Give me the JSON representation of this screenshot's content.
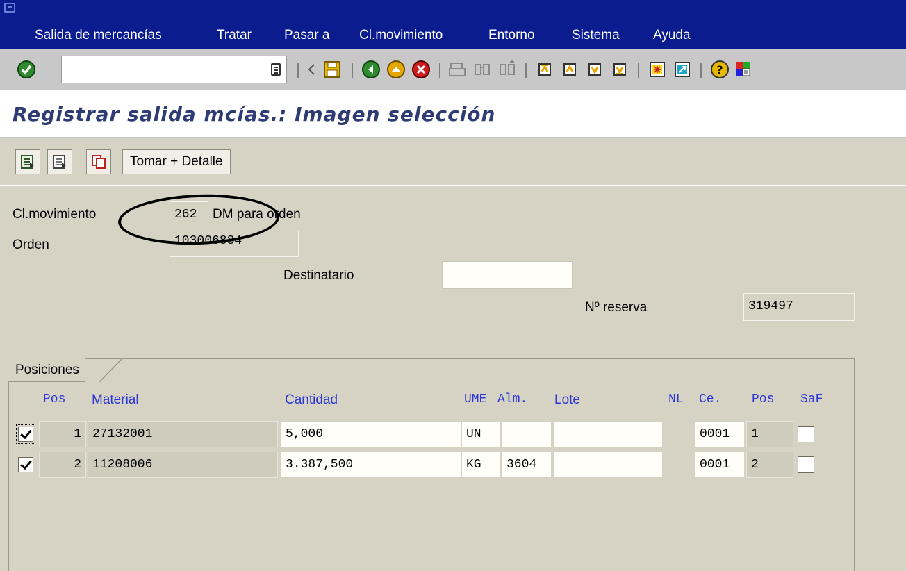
{
  "menu": {
    "items": [
      {
        "label": "Salida de mercancías"
      },
      {
        "label": "Tratar"
      },
      {
        "label": "Pasar a"
      },
      {
        "label": "Cl.movimiento"
      },
      {
        "label": "Entorno"
      },
      {
        "label": "Sistema"
      },
      {
        "label": "Ayuda"
      }
    ]
  },
  "toolbar": {
    "command_value": "",
    "icons": [
      "enter-icon",
      "command-history-icon",
      "back-triangle-icon",
      "save-icon",
      "back-icon",
      "exit-icon",
      "cancel-icon",
      "print-icon",
      "find-icon",
      "find-next-icon",
      "first-page-icon",
      "previous-page-icon",
      "next-page-icon",
      "last-page-icon",
      "create-session-icon",
      "shortcut-icon",
      "help-icon",
      "layout-menu-icon"
    ]
  },
  "title": "Registrar salida mcías.: Imagen selección",
  "app_toolbar": {
    "icons": [
      "select-all-icon",
      "deselect-all-icon",
      "copy-icon"
    ],
    "detail_button": "Tomar + Detalle"
  },
  "header": {
    "movement_label": "Cl.movimiento",
    "movement_value": "262",
    "movement_text": "DM para orden",
    "order_label": "Orden",
    "order_value": "103006884",
    "recipient_label": "Destinatario",
    "recipient_value": "",
    "reservation_label": "Nº reserva",
    "reservation_value": "319497"
  },
  "positions": {
    "tab_label": "Posiciones",
    "columns": {
      "pos": "Pos",
      "material": "Material",
      "cantidad": "Cantidad",
      "ume": "UME",
      "alm": "Alm.",
      "lote": "Lote",
      "nl": "NL",
      "ce": "Ce.",
      "pos2": "Pos",
      "saf": "SaF"
    },
    "rows": [
      {
        "selected": true,
        "pos": "1",
        "material": "27132001",
        "cantidad": "5,000",
        "ume": "UN",
        "alm": "",
        "lote": "",
        "ce": "0001",
        "pos2": "1",
        "saf": false
      },
      {
        "selected": true,
        "pos": "2",
        "material": "11208006",
        "cantidad": "3.387,500",
        "ume": "KG",
        "alm": "3604",
        "lote": "",
        "ce": "0001",
        "pos2": "2",
        "saf": false
      }
    ]
  },
  "colors": {
    "menubar": "#0a1c8e",
    "title": "#2f3c73",
    "background": "#d6d3c4",
    "column_header": "#2a36d8"
  }
}
